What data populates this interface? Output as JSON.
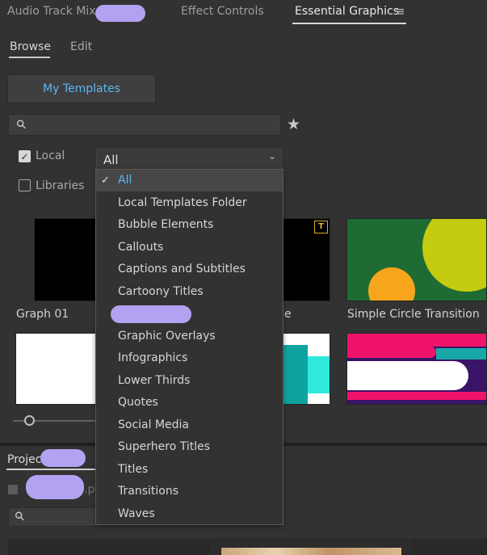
{
  "tabs": {
    "audio_track_mixer": "Audio Track Mixer",
    "effect_controls": "Effect Controls",
    "essential_graphics": "Essential Graphics",
    "menu_icon": "hamburger-menu-icon"
  },
  "subtabs": {
    "browse": "Browse",
    "edit": "Edit"
  },
  "my_templates_button": "My Templates",
  "search": {
    "placeholder": "",
    "value": "",
    "icon": "search-icon"
  },
  "favorites_icon": "star-icon",
  "filters": {
    "local": {
      "label": "Local",
      "checked": true
    },
    "libraries": {
      "label": "Libraries",
      "checked": false
    }
  },
  "category_select": {
    "value": "All"
  },
  "dropdown": {
    "items": [
      "All",
      "Local Templates Folder",
      "Bubble Elements",
      "Callouts",
      "Captions and Subtitles",
      "Cartoony Titles",
      "",
      "Graphic Overlays",
      "Infographics",
      "Lower Thirds",
      "Quotes",
      "Social Media",
      "Superhero Titles",
      "Titles",
      "Transitions",
      "Waves"
    ],
    "selected_index": 0
  },
  "templates": [
    {
      "label": "Graph 01"
    },
    {
      "label": "e"
    },
    {
      "label": "Simple Circle Transition"
    }
  ],
  "project_panel": {
    "tab_label": "Project",
    "file_suffix": ".p"
  },
  "colors": {
    "accent_blue": "#5cb6f2",
    "panel_bg": "#323232",
    "redaction": "#b3a2f2"
  }
}
